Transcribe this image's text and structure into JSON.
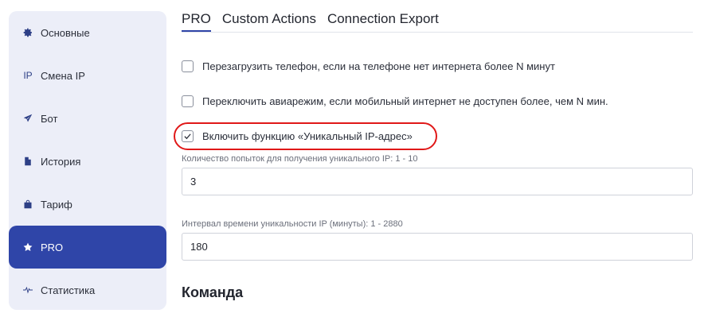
{
  "sidebar": {
    "items": [
      {
        "label": "Основные",
        "icon": "gear-icon"
      },
      {
        "label": "Смена IP",
        "icon": "ip-icon",
        "icon_text": "IP"
      },
      {
        "label": "Бот",
        "icon": "paper-plane-icon"
      },
      {
        "label": "История",
        "icon": "document-icon"
      },
      {
        "label": "Тариф",
        "icon": "bag-icon"
      },
      {
        "label": "PRO",
        "icon": "star-icon",
        "active": true
      },
      {
        "label": "Статистика",
        "icon": "pulse-icon"
      }
    ]
  },
  "tabs": [
    {
      "label": "PRO",
      "active": true
    },
    {
      "label": "Custom Actions"
    },
    {
      "label": "Connection Export"
    }
  ],
  "options": [
    {
      "label": "Перезагрузить телефон, если на телефоне нет интернета более N минут",
      "checked": false
    },
    {
      "label": "Переключить авиарежим, если мобильный интернет не доступен более, чем N мин.",
      "checked": false
    },
    {
      "label": "Включить функцию «Уникальный IP-адрес»",
      "checked": true
    }
  ],
  "fields": {
    "attempts_label": "Количество попыток для получения уникального IP: 1 - 10",
    "attempts_value": "3",
    "interval_label": "Интервал времени уникальности IP (минуты): 1 - 2880",
    "interval_value": "180"
  },
  "section_title": "Команда",
  "colors": {
    "accent": "#2f45a8",
    "sidebar_bg": "#eceef8",
    "highlight": "#e01818"
  }
}
